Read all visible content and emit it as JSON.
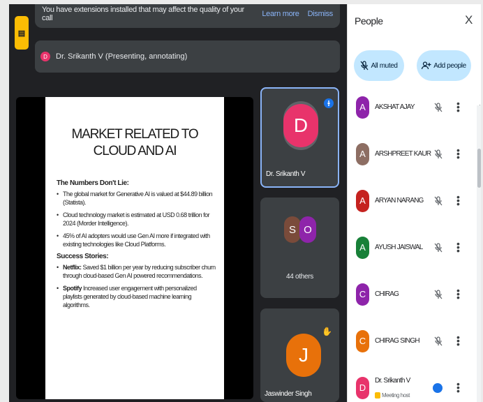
{
  "banner": {
    "message": "You have extensions installed that may affect the quality of your call",
    "learn_more": "Learn more",
    "dismiss": "Dismiss"
  },
  "presenting": {
    "initial": "D",
    "text": "Dr. Srikanth V (Presenting, annotating)"
  },
  "slide": {
    "title": "MARKET RELATED TO CLOUD AND AI",
    "numbers_heading": "The Numbers Don't Lie:",
    "bullets": [
      "The global market for Generative AI is valued at $44.89 billion (Statista).",
      "Cloud technology market is estimated at USD 0.68 trillion for 2024 (Morder Intelligence).",
      "45% of AI adopters would use Gen AI more if integrated with existing technologies like Cloud Platforms."
    ],
    "stories_heading": "Success Stories:",
    "stories": [
      {
        "brand": "Netflix:",
        "text": " Saved $1 billion per year by reducing subscriber churn through cloud-based Gen AI powered recommendations."
      },
      {
        "brand": "Spotify",
        "text": " Increased user engagement with personalized playlists generated by cloud-based machine learning algorithms."
      }
    ]
  },
  "tiles": {
    "presenter": {
      "initial": "D",
      "name": "Dr. Srikanth V",
      "color": "#e8336b"
    },
    "others": {
      "initials": [
        "S",
        "O"
      ],
      "colors": [
        "#7a4b3a",
        "#8e24aa"
      ],
      "label": "44 others"
    },
    "jaswinder": {
      "initial": "J",
      "name": "Jaswinder Singh",
      "color": "#e8710a"
    }
  },
  "people": {
    "title": "People",
    "close": "X",
    "all_muted": "All muted",
    "add_people": "Add people",
    "participants": [
      {
        "initial": "A",
        "name": "AKSHAT AJAY",
        "color": "#8e24aa"
      },
      {
        "initial": "A",
        "name": "ARSHPREET KAUR",
        "color": "#8d6e63"
      },
      {
        "initial": "A",
        "name": "ARYAN NARANG",
        "color": "#c5221f"
      },
      {
        "initial": "A",
        "name": "AYUSH JAISWAL",
        "color": "#188038"
      },
      {
        "initial": "C",
        "name": "CHIRAG",
        "color": "#8e24aa"
      },
      {
        "initial": "C",
        "name": "CHIRAG SINGH",
        "color": "#e8710a"
      },
      {
        "initial": "D",
        "name": "Dr. Srikanth V",
        "color": "#e8336b",
        "sub": "Meeting host"
      }
    ]
  },
  "icons": {
    "notification": "extension-icon",
    "mic_off": "mic-off-icon",
    "add_person": "person-add-icon",
    "more": "more-vert-icon",
    "pin": "pin-icon",
    "hand": "hand-icon"
  },
  "colors": {
    "meet_bg": "#202124",
    "surface": "#3c4043",
    "accent": "#1a73e8",
    "pill": "#c2e7ff"
  }
}
